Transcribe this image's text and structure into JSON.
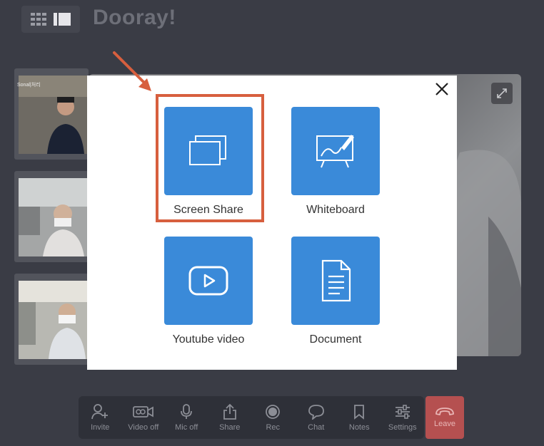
{
  "app": {
    "title": "Dooray!"
  },
  "thumbnails": [
    {
      "label": "Sonal|처리"
    },
    {
      "label": ""
    },
    {
      "label": ""
    }
  ],
  "modal": {
    "options": [
      {
        "label": "Screen Share",
        "icon": "screen-share-icon"
      },
      {
        "label": "Whiteboard",
        "icon": "whiteboard-icon"
      },
      {
        "label": "Youtube video",
        "icon": "youtube-icon"
      },
      {
        "label": "Document",
        "icon": "document-icon"
      }
    ],
    "accent_color": "#3a8ad9",
    "highlight_color": "#d75f3e"
  },
  "toolbar": {
    "items": [
      {
        "label": "Invite",
        "icon": "invite-icon"
      },
      {
        "label": "Video off",
        "icon": "video-icon"
      },
      {
        "label": "Mic off",
        "icon": "mic-icon"
      },
      {
        "label": "Share",
        "icon": "share-icon"
      },
      {
        "label": "Rec",
        "icon": "record-icon"
      },
      {
        "label": "Chat",
        "icon": "chat-icon"
      },
      {
        "label": "Notes",
        "icon": "bookmark-icon"
      },
      {
        "label": "Settings",
        "icon": "sliders-icon"
      }
    ],
    "leave_label": "Leave"
  }
}
